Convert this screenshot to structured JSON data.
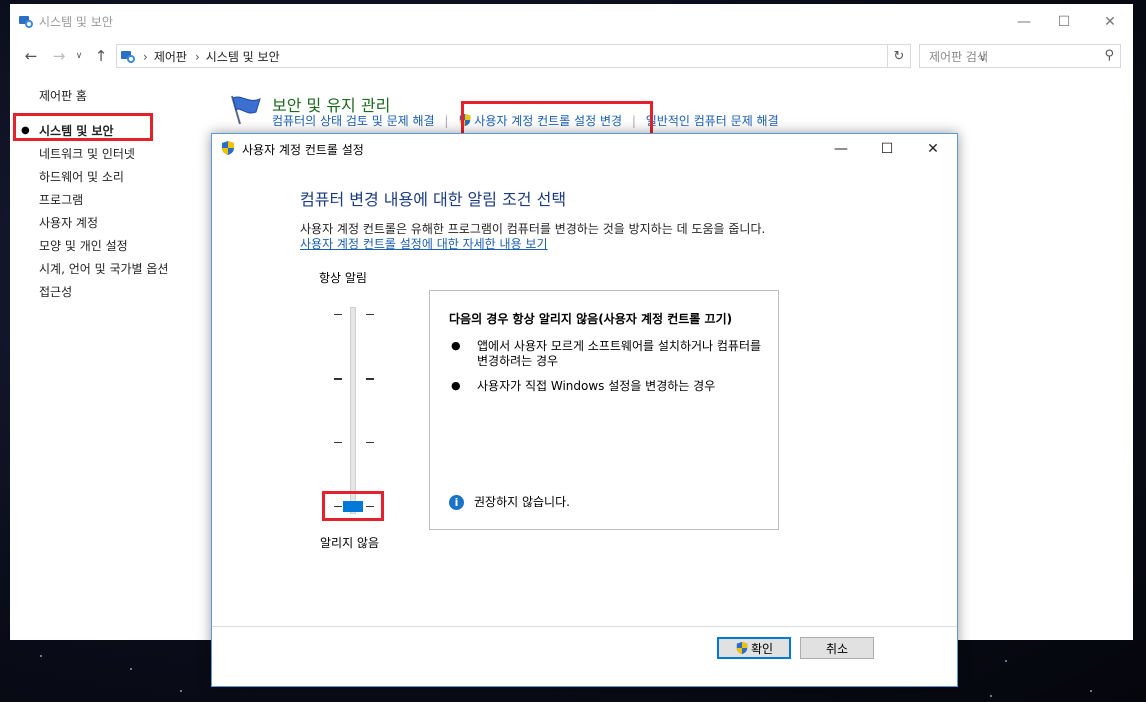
{
  "window": {
    "title": "시스템 및 보안"
  },
  "address": {
    "crumbs": [
      "제어판",
      "시스템 및 보안"
    ],
    "search_placeholder": "제어판 검색"
  },
  "sidebar": {
    "home": "제어판 홈",
    "active": "시스템 및 보안",
    "items": [
      "네트워크 및 인터넷",
      "하드웨어 및 소리",
      "프로그램",
      "사용자 계정",
      "모양 및 개인 설정",
      "시계, 언어 및 국가별 옵션",
      "접근성"
    ]
  },
  "section": {
    "title": "보안 및 유지 관리",
    "links": [
      "컴퓨터의 상태 검토 및 문제 해결",
      "사용자 계정 컨트롤 설정 변경",
      "일반적인 컴퓨터 문제 해결"
    ]
  },
  "dialog": {
    "title": "사용자 계정 컨트롤 설정",
    "heading": "컴퓨터 변경 내용에 대한 알림 조건 선택",
    "description": "사용자 계정 컨트롤은 유해한 프로그램이 컴퓨터를 변경하는 것을 방지하는 데 도움을 줍니다.",
    "more_link": "사용자 계정 컨트롤 설정에 대한 자세한 내용 보기",
    "slider": {
      "top_label": "항상 알림",
      "bottom_label": "알리지 않음",
      "level": 0,
      "levels": 4
    },
    "info_heading": "다음의 경우 항상 알리지 않음(사용자 계정 컨트롤 끄기)",
    "bullets": [
      "앱에서 사용자 모르게 소프트웨어를 설치하거나 컴퓨터를 변경하려는 경우",
      "사용자가 직접 Windows 설정을 변경하는 경우"
    ],
    "warning": "권장하지 않습니다.",
    "ok_label": "확인",
    "cancel_label": "취소"
  },
  "colors": {
    "accent": "#0078d7",
    "highlight": "#e3222b",
    "link": "#1a5fb4",
    "section_title": "#1e6a1e",
    "heading": "#1b3b82"
  }
}
